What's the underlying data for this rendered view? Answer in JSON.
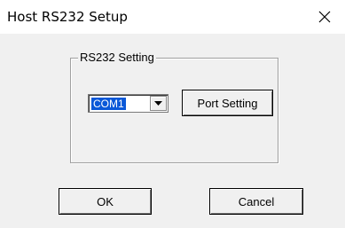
{
  "window": {
    "title": "Host RS232 Setup",
    "close_icon": "close-icon"
  },
  "rs232_group": {
    "label": "RS232 Setting",
    "port_combo": {
      "selected_value": "COM1",
      "arrow_icon": "chevron-down-icon"
    },
    "port_setting_label": "Port Setting"
  },
  "buttons": {
    "ok_label": "OK",
    "cancel_label": "Cancel"
  },
  "colors": {
    "selection_highlight": "#0a58d8",
    "dialog_background": "#f0f0f0",
    "titlebar_background": "#ffffff"
  }
}
